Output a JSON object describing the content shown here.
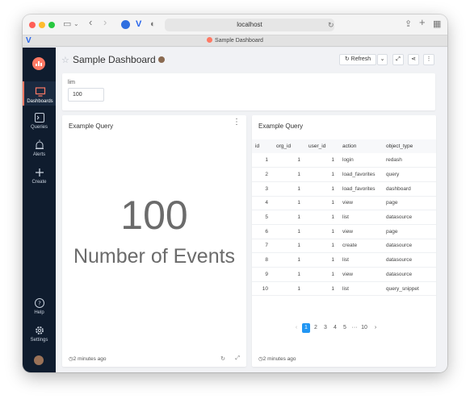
{
  "browser": {
    "url": "localhost",
    "tab_title": "Sample Dashboard"
  },
  "sidebar": {
    "items": [
      {
        "label": "Dashboards"
      },
      {
        "label": "Queries"
      },
      {
        "label": "Alerts"
      },
      {
        "label": "Create"
      }
    ],
    "bottom": [
      {
        "label": "Help"
      },
      {
        "label": "Settings"
      }
    ]
  },
  "dashboard": {
    "title": "Sample Dashboard",
    "refresh_label": "Refresh"
  },
  "parameter": {
    "label": "lim",
    "value": "100"
  },
  "counter_widget": {
    "title": "Example Query",
    "value": "100",
    "label": "Number of Events",
    "timestamp": "2 minutes ago"
  },
  "table_widget": {
    "title": "Example Query",
    "columns": [
      "id",
      "org_id",
      "user_id",
      "action",
      "object_type"
    ],
    "rows": [
      [
        "1",
        "1",
        "1",
        "login",
        "redash"
      ],
      [
        "2",
        "1",
        "1",
        "load_favorites",
        "query"
      ],
      [
        "3",
        "1",
        "1",
        "load_favorites",
        "dashboard"
      ],
      [
        "4",
        "1",
        "1",
        "view",
        "page"
      ],
      [
        "5",
        "1",
        "1",
        "list",
        "datasource"
      ],
      [
        "6",
        "1",
        "1",
        "view",
        "page"
      ],
      [
        "7",
        "1",
        "1",
        "create",
        "datasource"
      ],
      [
        "8",
        "1",
        "1",
        "list",
        "datasource"
      ],
      [
        "9",
        "1",
        "1",
        "view",
        "datasource"
      ],
      [
        "10",
        "1",
        "1",
        "list",
        "query_snippet"
      ]
    ],
    "pages": [
      "1",
      "2",
      "3",
      "4",
      "5",
      "···",
      "10"
    ],
    "current_page": "1",
    "timestamp": "2 minutes ago"
  },
  "colors": {
    "sidebar": "#0f1c2e",
    "accent": "#ff7964",
    "pager_active": "#2196f3"
  }
}
